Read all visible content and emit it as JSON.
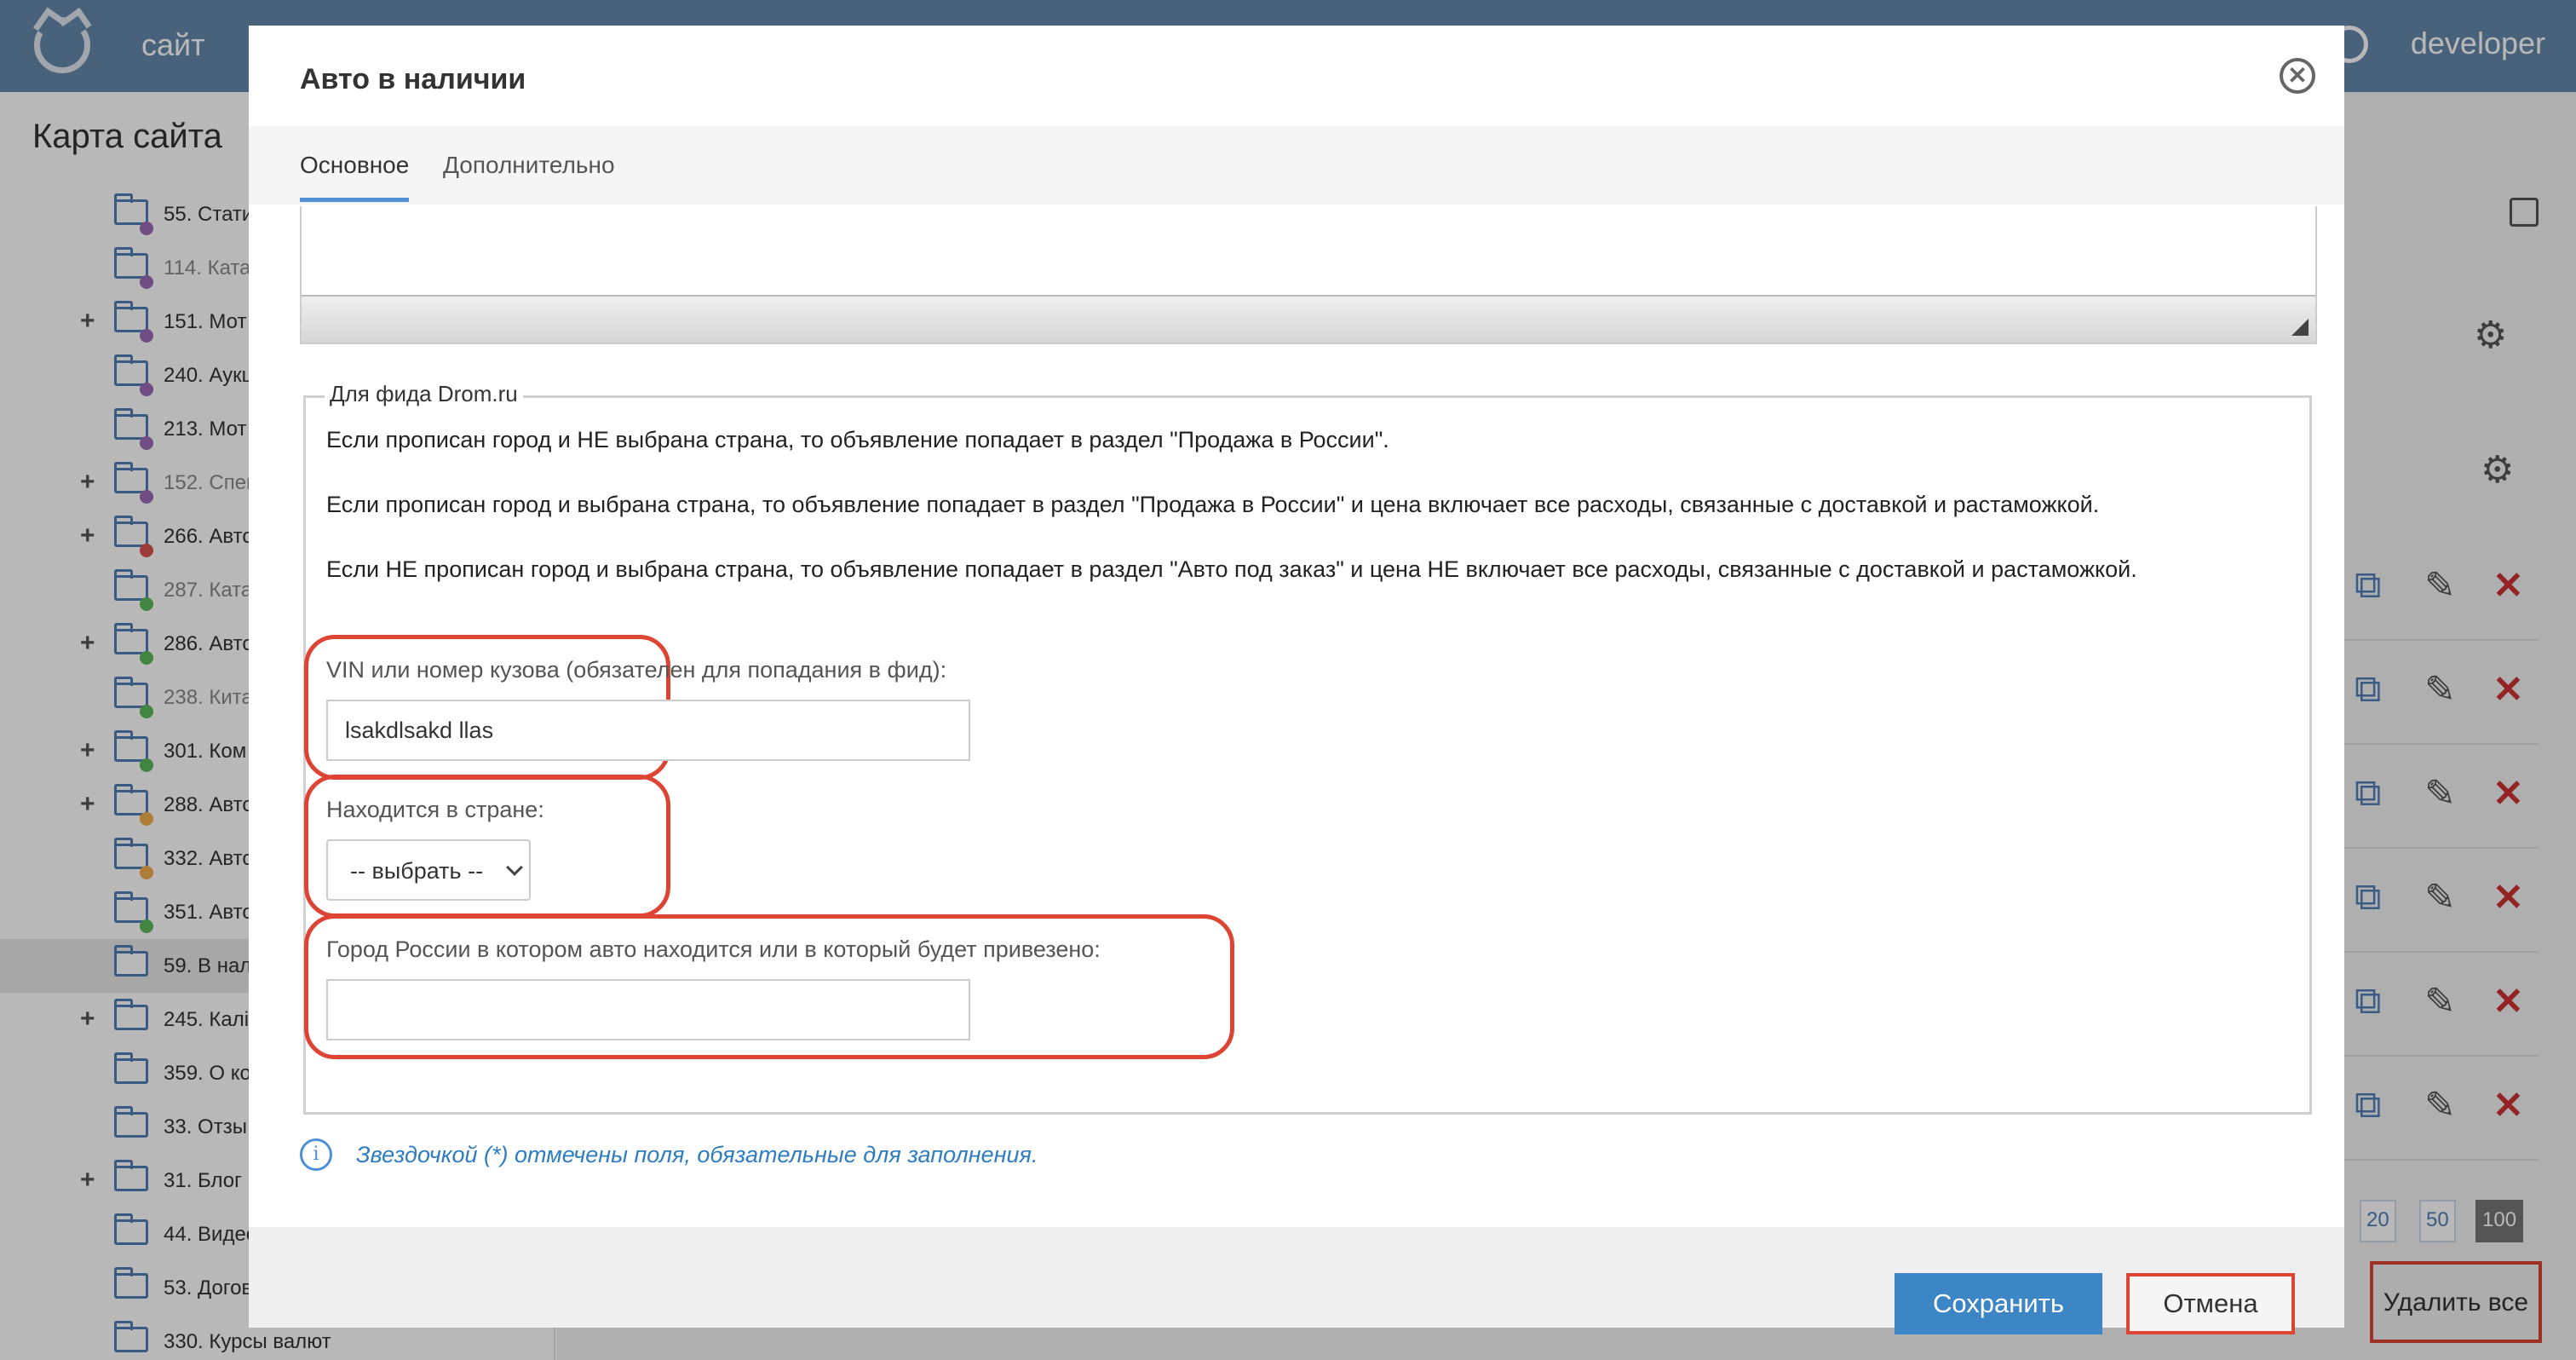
{
  "topbar": {
    "site_label": "сайт",
    "user_label": "developer"
  },
  "left": {
    "title": "Карта сайта",
    "tree": [
      {
        "label": "55. Стати",
        "plus": false,
        "dot": "#9b6bb6",
        "dim": false
      },
      {
        "label": "114. Ката",
        "plus": false,
        "dot": "#9b6bb6",
        "dim": true
      },
      {
        "label": "151. Мот",
        "plus": true,
        "dot": "#9b6bb6",
        "dim": false
      },
      {
        "label": "240. Аукц",
        "plus": false,
        "dot": "#9b6bb6",
        "dim": false
      },
      {
        "label": "213. Мот",
        "plus": false,
        "dot": "#9b6bb6",
        "dim": false
      },
      {
        "label": "152. Спец",
        "plus": true,
        "dot": "#9b6bb6",
        "dim": true
      },
      {
        "label": "266. Авто",
        "plus": true,
        "dot": "#d9534f",
        "dim": false
      },
      {
        "label": "287. Ката",
        "plus": false,
        "dot": "#5cb85c",
        "dim": true
      },
      {
        "label": "286. Авто",
        "plus": true,
        "dot": "#5cb85c",
        "dim": false
      },
      {
        "label": "238. Кита",
        "plus": false,
        "dot": "#5cb85c",
        "dim": true
      },
      {
        "label": "301. Ком",
        "plus": true,
        "dot": "#5cb85c",
        "dim": false
      },
      {
        "label": "288. Авто",
        "plus": true,
        "dot": "#f0ad4e",
        "dim": false
      },
      {
        "label": "332. Авто",
        "plus": false,
        "dot": "#f0ad4e",
        "dim": false
      },
      {
        "label": "351. Авто",
        "plus": false,
        "dot": "#5cb85c",
        "dim": false
      },
      {
        "label": "59. В нал",
        "plus": false,
        "dot": "",
        "dim": false,
        "active": true
      },
      {
        "label": "245. Калі",
        "plus": true,
        "dot": "",
        "dim": false
      },
      {
        "label": "359. О ко",
        "plus": false,
        "dot": "",
        "dim": false
      },
      {
        "label": "33. Отзы",
        "plus": false,
        "dot": "",
        "dim": false
      },
      {
        "label": "31. Блог",
        "plus": true,
        "dot": "",
        "dim": false
      },
      {
        "label": "44. Видео",
        "plus": false,
        "dot": "",
        "dim": false
      },
      {
        "label": "53. Догов",
        "plus": false,
        "dot": "",
        "dim": false
      },
      {
        "label": "330. Курсы валют",
        "plus": false,
        "dot": "",
        "dim": false
      }
    ]
  },
  "right": {
    "pager": [
      "20",
      "50",
      "100"
    ],
    "delete_all_label": "Удалить все"
  },
  "modal": {
    "title": "Авто в наличии",
    "close_glyph": "✕",
    "tabs": [
      {
        "label": "Основное",
        "active": true
      },
      {
        "label": "Дополнительно",
        "active": false
      }
    ],
    "fieldset": {
      "legend": "Для фида Drom.ru",
      "info_1": "Если прописан город и НЕ выбрана страна, то объявление попадает в раздел \"Продажа в России\".",
      "info_2": "Если прописан город и выбрана страна, то объявление попадает в раздел \"Продажа в России\" и цена включает все расходы, связанные с доставкой и растаможкой.",
      "info_3": "Если НЕ прописан город и выбрана страна, то объявление попадает в раздел \"Авто под заказ\" и цена НЕ включает все расходы, связанные с доставкой и растаможкой.",
      "vin_label": "VIN или номер кузова (обязателен для попадания в фид):",
      "vin_value": "lsakdlsakd llas",
      "country_label": "Находится в стране:",
      "country_value": "-- выбрать --",
      "city_label": "Город России в котором авто находится или в который будет привезено:",
      "city_value": ""
    },
    "note_glyph": "i",
    "note": "Звездочкой (*) отмечены поля, обязательные для заполнения.",
    "save_label": "Сохранить",
    "cancel_label": "Отмена"
  },
  "colors": {
    "topbar": "#6688ac",
    "accent": "#3d86c6",
    "highlight": "#dd4433",
    "note": "#2f7dbf"
  }
}
